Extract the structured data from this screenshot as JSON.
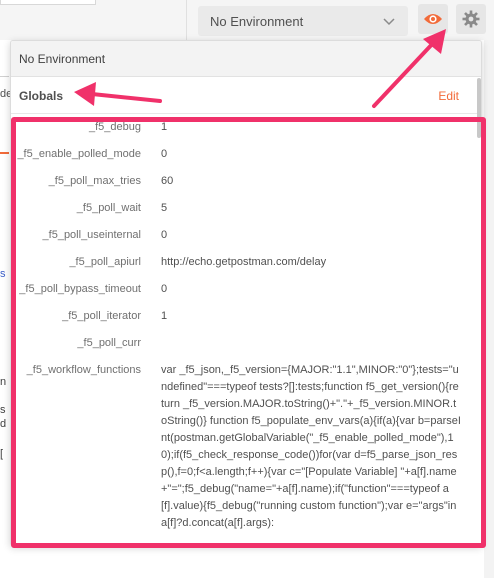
{
  "header": {
    "environment_select": "No Environment",
    "eye_icon": "eye-icon",
    "gear_icon": "gear-icon",
    "chevron_icon": "chevron-down-icon"
  },
  "background_fragments": [
    "de",
    "s",
    "n",
    "s",
    "d",
    "["
  ],
  "popup": {
    "no_environment_label": "No Environment",
    "globals_title": "Globals",
    "edit_label": "Edit",
    "variables": [
      {
        "key": "_f5_debug",
        "value": "1"
      },
      {
        "key": "_f5_enable_polled_mode",
        "value": "0"
      },
      {
        "key": "_f5_poll_max_tries",
        "value": "60"
      },
      {
        "key": "_f5_poll_wait",
        "value": "5"
      },
      {
        "key": "_f5_poll_useinternal",
        "value": "0"
      },
      {
        "key": "_f5_poll_apiurl",
        "value": "http://echo.getpostman.com/delay"
      },
      {
        "key": "_f5_poll_bypass_timeout",
        "value": "0"
      },
      {
        "key": "_f5_poll_iterator",
        "value": "1"
      },
      {
        "key": "_f5_poll_curr",
        "value": ""
      },
      {
        "key": "_f5_workflow_functions",
        "value": "var _f5_json,_f5_version={MAJOR:\"1.1\",MINOR:\"0\"};tests=\"undefined\"===typeof tests?[]:tests;function f5_get_version(){return _f5_version.MAJOR.toString()+\".\"+_f5_version.MINOR.toString()} function f5_populate_env_vars(a){if(a){var b=parseInt(postman.getGlobalVariable(\"_f5_enable_polled_mode\"),10);if(f5_check_response_code())for(var d=f5_parse_json_resp(),f=0;f<a.length;f++){var c=\"[Populate Variable] \"+a[f].name+\"=\";f5_debug(\"name=\"+a[f].name);if(\"function\"===typeof a[f].value){f5_debug(\"running custom function\");var e=\"args\"in a[f]?d.concat(a[f].args):"
      }
    ]
  },
  "colors": {
    "accent_orange": "#f26b3a",
    "annotation_pink": "#f0316a"
  }
}
